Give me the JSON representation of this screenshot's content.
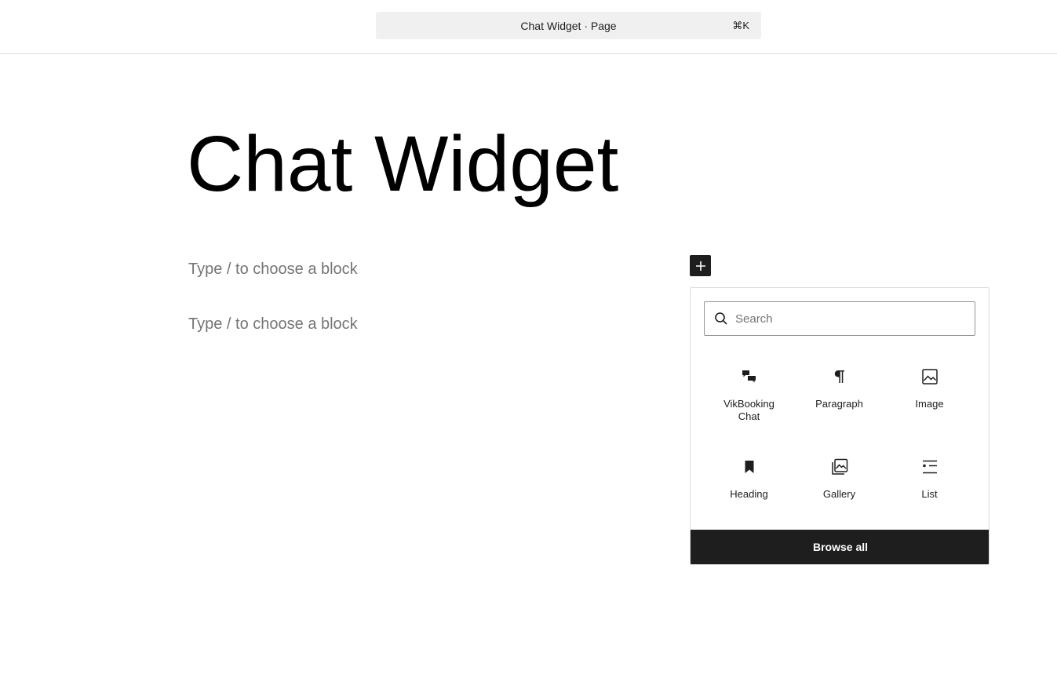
{
  "header": {
    "command_bar_title": "Chat Widget · Page",
    "command_bar_shortcut": "⌘K"
  },
  "editor": {
    "title": "Chat Widget",
    "block_placeholders": [
      "Type / to choose a block",
      "Type / to choose a block"
    ]
  },
  "inserter": {
    "toggle_icon": "plus-icon",
    "search_placeholder": "Search",
    "blocks": [
      {
        "label": "VikBooking Chat",
        "icon": "chat-bubbles-icon"
      },
      {
        "label": "Paragraph",
        "icon": "paragraph-icon"
      },
      {
        "label": "Image",
        "icon": "image-icon"
      },
      {
        "label": "Heading",
        "icon": "bookmark-icon"
      },
      {
        "label": "Gallery",
        "icon": "gallery-icon"
      },
      {
        "label": "List",
        "icon": "list-icon"
      }
    ],
    "browse_all_label": "Browse all"
  }
}
